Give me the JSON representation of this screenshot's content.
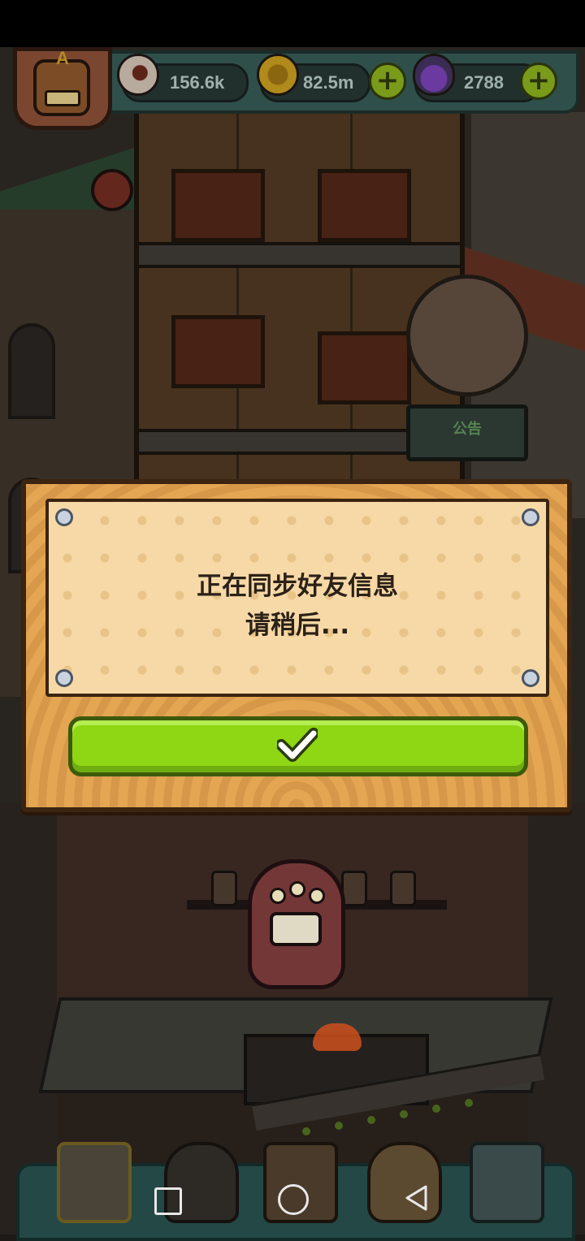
{
  "hud": {
    "avatar_letter": "A",
    "resources": [
      {
        "name": "eyes",
        "icon": "eyeball-icon",
        "value": "156.6k"
      },
      {
        "name": "coins",
        "icon": "coin-icon",
        "value": "82.5m"
      },
      {
        "name": "potions",
        "icon": "potion-icon",
        "value": "2788"
      }
    ],
    "plus_label": "+"
  },
  "scene": {
    "notice_board_label": "公告"
  },
  "dialog": {
    "message_line1": "正在同步好友信息",
    "message_line2": "请稍后...",
    "confirm_icon": "checkmark-icon",
    "accent_color": "#8fd614"
  },
  "bottom_nav": {
    "tabs": [
      "build-tab-icon",
      "bag-tab-icon",
      "book-tab-icon",
      "sack-tab-icon",
      "friends-tab-icon"
    ]
  },
  "system_nav": [
    "recent-apps-icon",
    "home-icon",
    "back-icon"
  ]
}
